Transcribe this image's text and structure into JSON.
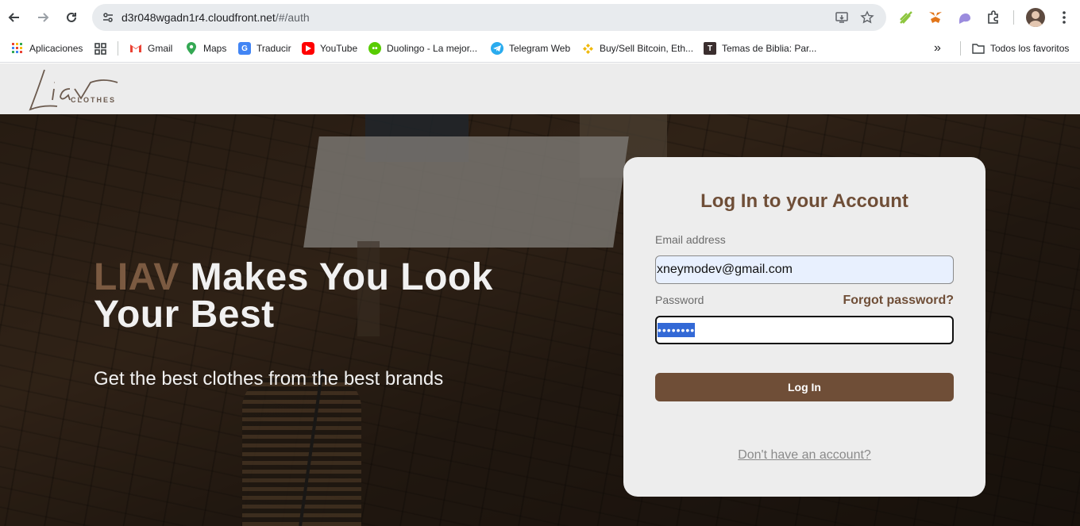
{
  "browser": {
    "url_host": "d3r048wgadn1r4.cloudfront.net",
    "url_path": "/#/auth",
    "bookmarks": [
      {
        "label": "Aplicaciones",
        "icon": "apps-grid-icon"
      },
      {
        "label": "",
        "icon": "qr-grid-icon"
      },
      {
        "label": "Gmail",
        "icon": "gmail-icon"
      },
      {
        "label": "Maps",
        "icon": "maps-pin-icon"
      },
      {
        "label": "Traducir",
        "icon": "translate-icon"
      },
      {
        "label": "YouTube",
        "icon": "youtube-icon"
      },
      {
        "label": "Duolingo - La mejor...",
        "icon": "duolingo-icon"
      },
      {
        "label": "Telegram Web",
        "icon": "telegram-icon"
      },
      {
        "label": "Buy/Sell Bitcoin, Eth...",
        "icon": "binance-icon"
      },
      {
        "label": "Temas de Biblia: Par...",
        "icon": "bible-icon"
      }
    ],
    "all_bookmarks_label": "Todos los favoritos"
  },
  "site": {
    "logo_text": "Liav",
    "logo_sub": "CLOTHES"
  },
  "hero": {
    "brand_word": "LIAV",
    "headline_rest": " Makes You Look Your Best",
    "subline": "Get the best clothes from the best brands"
  },
  "login": {
    "title": "Log In to your Account",
    "email_label": "Email address",
    "email_value": "xneymodev@gmail.com",
    "password_label": "Password",
    "password_masked": "••••••••",
    "forgot_label": "Forgot password?",
    "submit_label": "Log In",
    "signup_label": "Don't have an account?"
  },
  "colors": {
    "brand_brown": "#6f4e37",
    "card_bg": "#ededed"
  }
}
